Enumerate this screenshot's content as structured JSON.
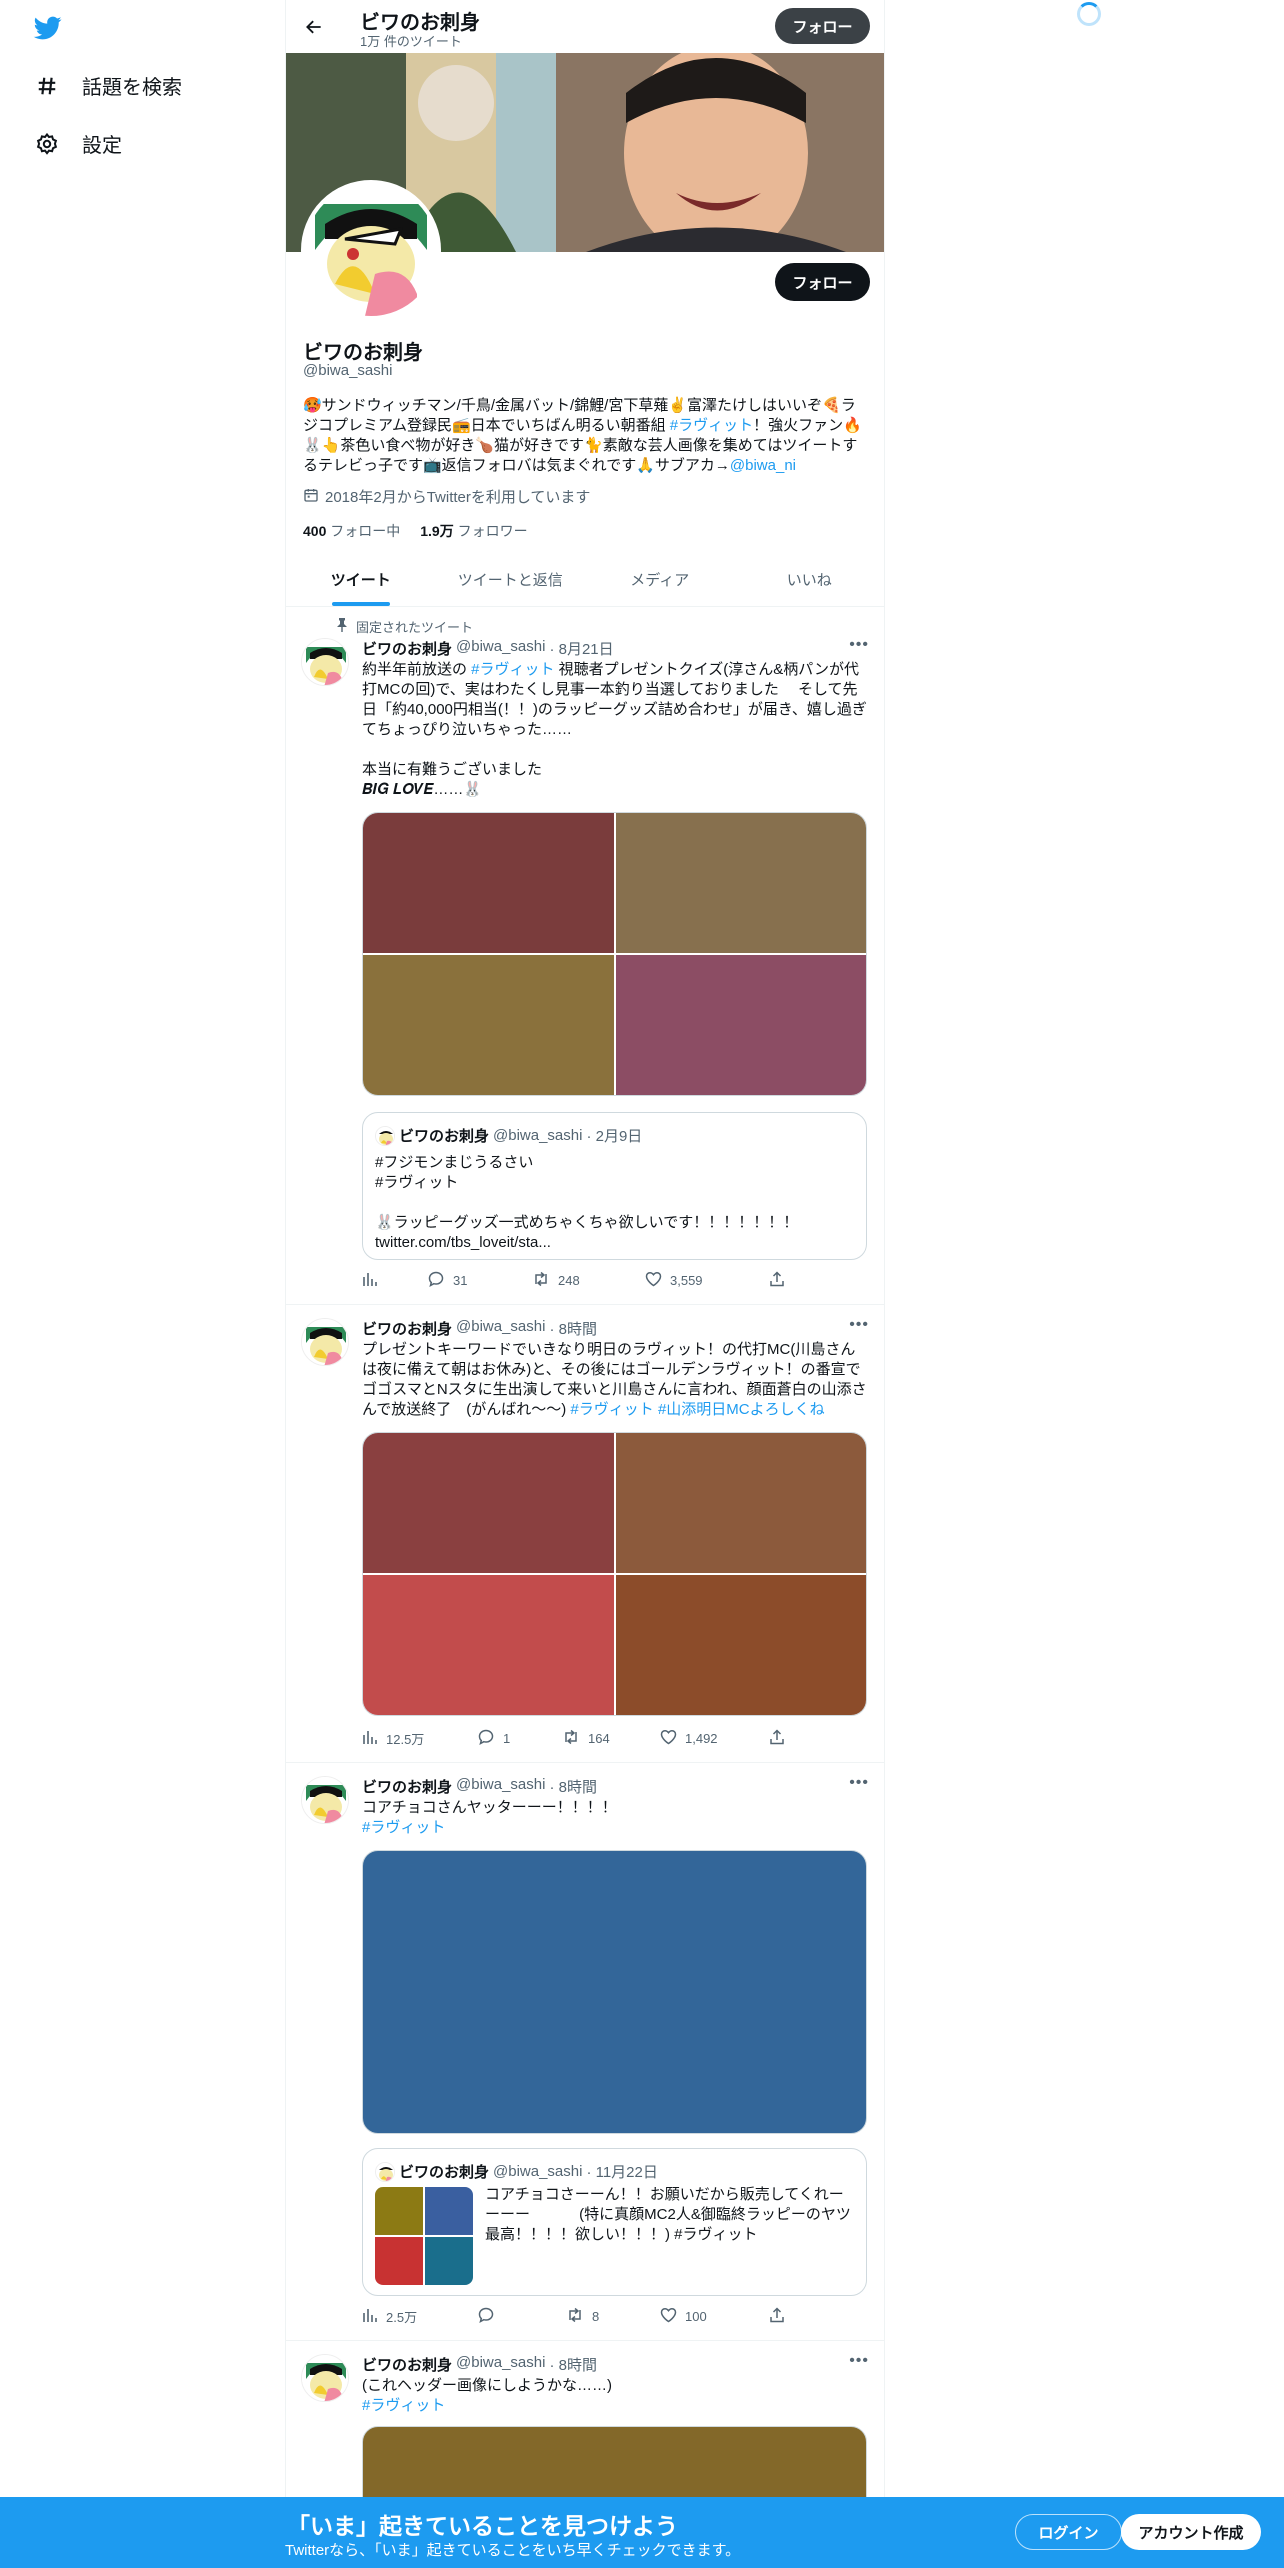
{
  "nav": {
    "items": [
      {
        "label": "話題を検索",
        "icon": "hashtag-icon"
      },
      {
        "label": "設定",
        "icon": "gear-icon"
      }
    ]
  },
  "header": {
    "name": "ビワのお刺身",
    "tweet_count": "1万 件のツイート",
    "follow_label": "フォロー"
  },
  "profile": {
    "name": "ビワのお刺身",
    "handle": "@biwa_sashi",
    "follow_label": "フォロー",
    "bio_text": "🥵サンドウィッチマン/千鳥/金属バット/錦鯉/宮下草薙✌️富澤たけしはいいぞ🍕ラジコプレミアム登録民📻日本でいちばん明るい朝番組 ",
    "bio_tag": "#ラヴィット",
    "bio_text2": "！強火ファン🔥🐰👆茶色い食べ物が好き🍗猫が好きです🐈素敵な芸人画像を集めてはツイートするテレビっ子です📺返信フォロバは気まぐれです🙏サブアカ→",
    "bio_link": "@biwa_ni",
    "joined": "2018年2月からTwitterを利用しています",
    "following_count": "400",
    "following_label": "フォロー中",
    "followers_count": "1.9万",
    "followers_label": "フォロワー"
  },
  "tabs": [
    "ツイート",
    "ツイートと返信",
    "メディア",
    "いいね"
  ],
  "tweets": [
    {
      "pinned_label": "固定されたツイート",
      "name": "ビワのお刺身",
      "handle": "@biwa_sashi",
      "time": "· 8月21日",
      "text_a": "約半年前放送の ",
      "tag": "#ラヴィット",
      "text_b": " 視聴者プレゼントクイズ(淳さん&柄パンが代打MCの回)で、実はわたくし見事一本釣り当選しておりました　 そして先日「約40,000円相当(！！)のラッピーグッズ詰め合わせ」が届き、嬉し過ぎてちょっぴり泣いちゃった……\n\n本当に有難うございました\n",
      "text_c": "𝑩𝑰𝑮 𝑳𝑶𝑽𝑬……🐰",
      "quote": {
        "name": "ビワのお刺身",
        "handle": "@biwa_sashi",
        "time": "· 2月9日",
        "text": "#フジモンまじうるさい\n#ラヴィット\n\n🐰ラッピーグッズ一式めちゃくちゃ欲しいです！！！！！！！\ntwitter.com/tbs_loveit/sta..."
      },
      "views": "",
      "replies": "31",
      "retweets": "248",
      "likes": "3,559"
    },
    {
      "name": "ビワのお刺身",
      "handle": "@biwa_sashi",
      "time": "· 8時間",
      "text_a": "プレゼントキーワードでいきなり明日のラヴィット！の代打MC(川島さんは夜に備えて朝はお休み)と、その後にはゴールデンラヴィット！の番宣でゴゴスマとNスタに生出演して来いと川島さんに言われ、顔面蒼白の山添さんで放送終了　(がんばれ～～) ",
      "tag": "#ラヴィット",
      "tag2": "#山添明日MCよろしくね",
      "views": "12.5万",
      "replies": "1",
      "retweets": "164",
      "likes": "1,492"
    },
    {
      "name": "ビワのお刺身",
      "handle": "@biwa_sashi",
      "time": "· 8時間",
      "text_a": "コアチョコさんヤッターーー！！！！",
      "tag": "#ラヴィット",
      "quote": {
        "name": "ビワのお刺身",
        "handle": "@biwa_sashi",
        "time": "· 11月22日",
        "text": "コアチョコさーーん！！お願いだから販売してくれーーーー　　　 (特に真顔MC2人&御臨終ラッピーのヤツ最高！！！！欲しい！！！) #ラヴィット"
      },
      "views": "2.5万",
      "replies": "",
      "retweets": "8",
      "likes": "100"
    },
    {
      "name": "ビワのお刺身",
      "handle": "@biwa_sashi",
      "time": "· 8時間",
      "text_a": "(これヘッダー画像にしようかな……)",
      "tag": "#ラヴィット"
    }
  ],
  "colors": {
    "accent": "#1d9bf0",
    "img_t1": [
      "#7a3c3c",
      "#87704e",
      "#8a713c",
      "#8c4d64"
    ],
    "img_t2": [
      "#8a4040",
      "#8c5a3c",
      "#c24c4c",
      "#8c4c2a"
    ],
    "img_t3": "#336699",
    "img_t3_quote": [
      "#8c7a14",
      "#3a5fa0",
      "#c83232",
      "#1a6e8c"
    ],
    "img_t4": "#836829"
  },
  "bottombar": {
    "title": "「いま」起きていることを見つけよう",
    "subtitle": "Twitterなら、「いま」起きていることをいち早くチェックできます。",
    "login": "ログイン",
    "signup": "アカウント作成"
  }
}
